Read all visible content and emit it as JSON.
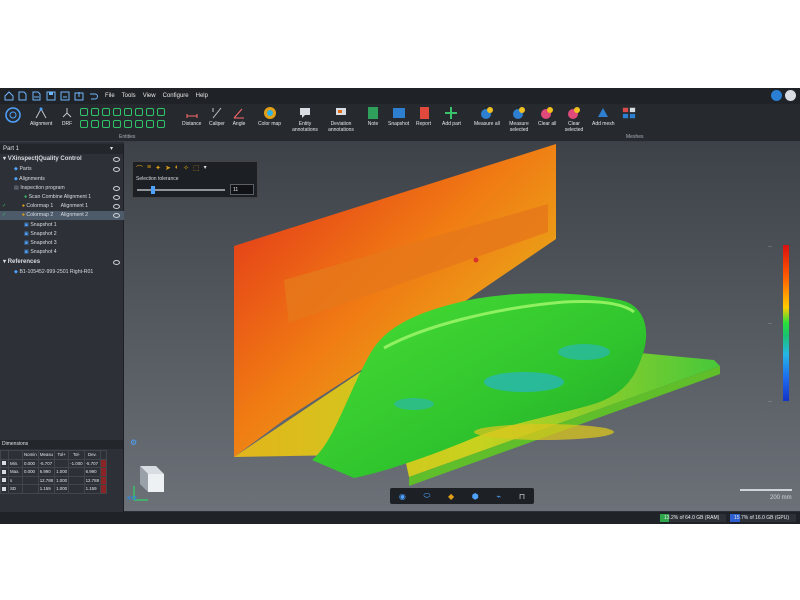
{
  "menu": {
    "items": [
      "File",
      "Tools",
      "View",
      "Configure",
      "Help"
    ]
  },
  "ribbon": {
    "alignment": "Alignment",
    "drf": "DRF",
    "entities_group": "Entities",
    "distance": "Distance",
    "caliper": "Caliper",
    "angle": "Angle",
    "color_map": "Color map",
    "entity_annotations": "Entity annotations",
    "deviation_annotations": "Deviation annotations",
    "note": "Note",
    "snapshot": "Snapshot",
    "report": "Report",
    "add_part": "Add part",
    "measure_all": "Measure all",
    "measure_selected": "Measure selected",
    "clear_all": "Clear all",
    "clear_selected": "Clear selected",
    "add_mesh": "Add mesh",
    "meshes_group": "Meshes"
  },
  "tree": {
    "part_selector": "Part 1",
    "root": "VXinspect|Quality Control",
    "parts": "Parts",
    "alignments": "Alignments",
    "inspection_program": "Inspection program",
    "scan_item": "Scan Combine Alignment 1",
    "colormap1": "Colormap 1",
    "colormap1_align": "Alignment 1",
    "colormap2": "Colormap 2",
    "colormap2_align": "Alignment 2",
    "snapshots": [
      "Snapshot 1",
      "Snapshot 2",
      "Snapshot 3",
      "Snapshot 4"
    ],
    "references": "References",
    "reference_item": "B1-105452-999-2501 Right-R01"
  },
  "dimensions": {
    "title": "Dimensions",
    "headers": [
      "",
      "Nomin",
      "Measu",
      "Tol+",
      "Tol-",
      "Dev."
    ],
    "rows": [
      [
        "Min.",
        "0.000",
        "-5.707",
        "",
        "-1.000",
        "-5.707"
      ],
      [
        "Max.",
        "0.000",
        "6.990",
        "1.000",
        "",
        "6.990"
      ],
      [
        "s",
        "",
        "12.788",
        "1.000",
        "",
        "12.788"
      ],
      [
        "SD",
        "",
        "1.159",
        "1.000",
        "",
        "1.159"
      ]
    ]
  },
  "toolbox": {
    "label": "Selection tolerance",
    "value": "11"
  },
  "viewport": {
    "scale_bar_label": "200 mm",
    "axis_label": "XYZ"
  },
  "status": {
    "ram": "13.2% of 64.0 GB (RAM)",
    "gpu": "15.7% of 16.0 GB (GPU)"
  },
  "colors": {
    "accent_green": "#30c56a",
    "selected_row": "#4c5a6a",
    "background": "#2b2f35"
  }
}
